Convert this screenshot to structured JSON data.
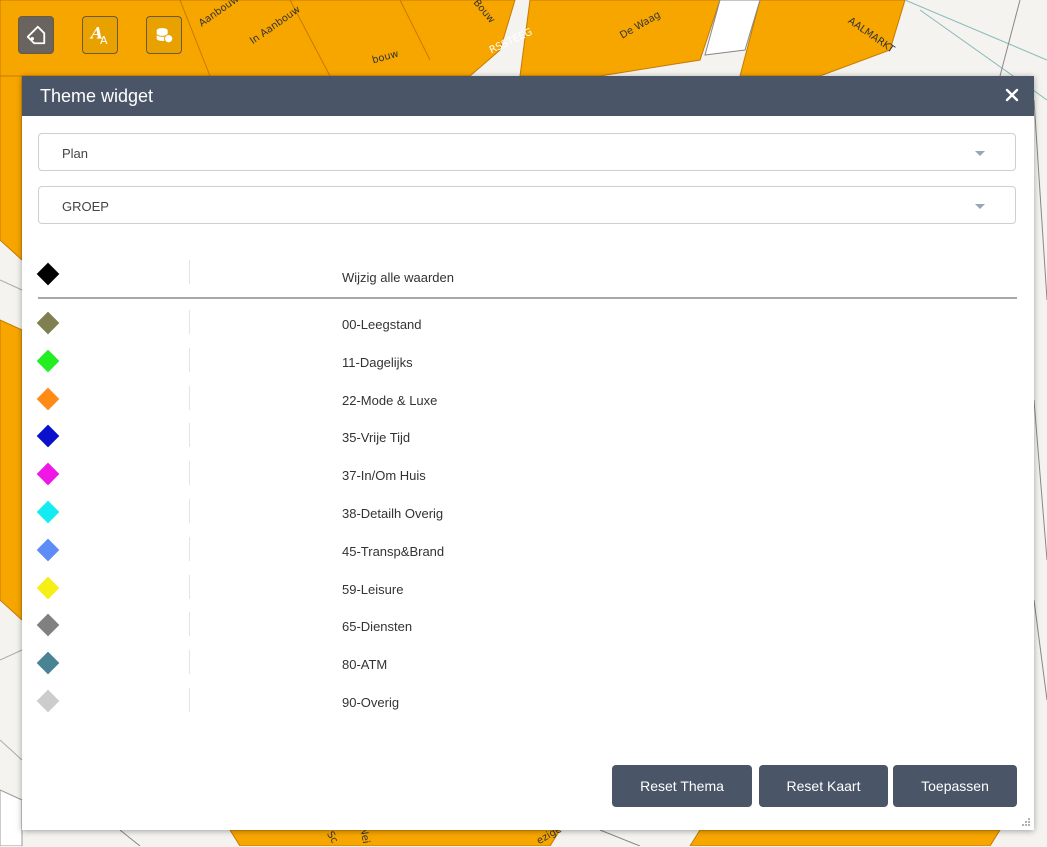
{
  "map": {
    "street_labels": [
      "In Aanbouw",
      "Aanbouw",
      "bouw",
      "Bouw",
      "RSSTEEG",
      "De Waag",
      "AALMARKT",
      "Nei",
      "Sc",
      "ezige"
    ]
  },
  "toolbar": {
    "buttons": [
      {
        "icon": "tag-icon",
        "bg": "#6a6460"
      },
      {
        "icon": "font-style-icon",
        "bg": "#e9a100"
      },
      {
        "icon": "database-icon",
        "bg": "#e9a100"
      }
    ]
  },
  "dialog": {
    "title": "Theme widget",
    "close_glyph": "×",
    "layer_select": {
      "value": "Plan"
    },
    "field_select": {
      "value": "GROEP"
    },
    "legend_header": {
      "label": "Wijzig alle waarden",
      "color": "#000000"
    },
    "legend": [
      {
        "label": "00-Leegstand",
        "color": "#7f7f4f"
      },
      {
        "label": "11-Dagelijks",
        "color": "#22ee22"
      },
      {
        "label": "22-Mode & Luxe",
        "color": "#ff8a16"
      },
      {
        "label": "35-Vrije Tijd",
        "color": "#0b10cc"
      },
      {
        "label": "37-In/Om Huis",
        "color": "#f016e6"
      },
      {
        "label": "38-Detailh Overig",
        "color": "#14ecf4"
      },
      {
        "label": "45-Transp&Brand",
        "color": "#5c8cf6"
      },
      {
        "label": "59-Leisure",
        "color": "#f6ee16"
      },
      {
        "label": "65-Diensten",
        "color": "#808080"
      },
      {
        "label": "80-ATM",
        "color": "#4a8494"
      },
      {
        "label": "90-Overig",
        "color": "#cccccc"
      }
    ],
    "buttons": {
      "reset_theme": "Reset Thema",
      "reset_map": "Reset Kaart",
      "apply": "Toepassen"
    }
  },
  "colors": {
    "header_bg": "#4a5568",
    "map_orange": "#f7a600",
    "button_bg": "#4a5568"
  }
}
